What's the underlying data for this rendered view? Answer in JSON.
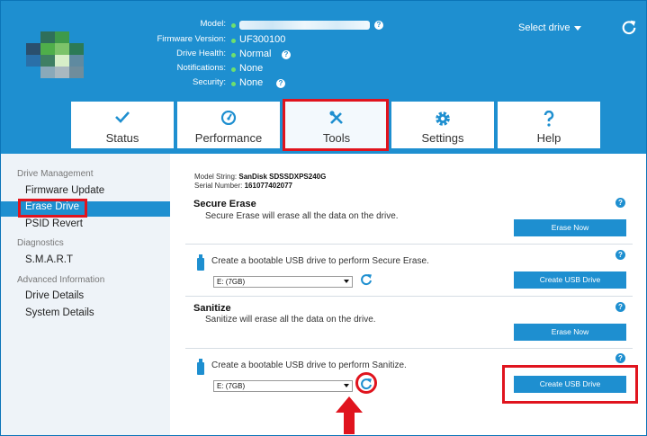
{
  "header": {
    "info": [
      {
        "label": "Model:",
        "value": ""
      },
      {
        "label": "Firmware Version:",
        "value": "UF300100"
      },
      {
        "label": "Drive Health:",
        "value": "Normal"
      },
      {
        "label": "Notifications:",
        "value": "None"
      },
      {
        "label": "Security:",
        "value": "None"
      }
    ],
    "select_drive": "Select drive"
  },
  "tabs": [
    {
      "label": "Status",
      "icon": "checkmark-icon"
    },
    {
      "label": "Performance",
      "icon": "gauge-icon"
    },
    {
      "label": "Tools",
      "icon": "tools-icon"
    },
    {
      "label": "Settings",
      "icon": "gear-icon"
    },
    {
      "label": "Help",
      "icon": "question-icon"
    }
  ],
  "sidebar": {
    "sections": [
      {
        "title": "Drive Management",
        "items": [
          "Firmware Update",
          "Erase Drive",
          "PSID Revert"
        ]
      },
      {
        "title": "Diagnostics",
        "items": [
          "S.M.A.R.T"
        ]
      },
      {
        "title": "Advanced Information",
        "items": [
          "Drive Details",
          "System Details"
        ]
      }
    ]
  },
  "main": {
    "model_string_label": "Model String:",
    "model_string": "SanDisk SDSSDXPS240G",
    "serial_label": "Serial Number:",
    "serial": "161077402077",
    "secure_erase": {
      "title": "Secure Erase",
      "desc": "Secure Erase will erase all the data on the drive.",
      "button": "Erase Now"
    },
    "usb_secure": {
      "text": "Create a bootable USB drive to perform Secure Erase.",
      "drive": "E: (7GB)",
      "button": "Create USB Drive"
    },
    "sanitize": {
      "title": "Sanitize",
      "desc": "Sanitize will erase all the data on the drive.",
      "button": "Erase Now"
    },
    "usb_sanitize": {
      "text": "Create a bootable USB drive to perform Sanitize.",
      "drive": "E: (7GB)",
      "button": "Create USB Drive"
    }
  },
  "colors": {
    "accent": "#1e8fd0",
    "highlight": "#e0141e",
    "status_ok": "#6ee06e"
  }
}
